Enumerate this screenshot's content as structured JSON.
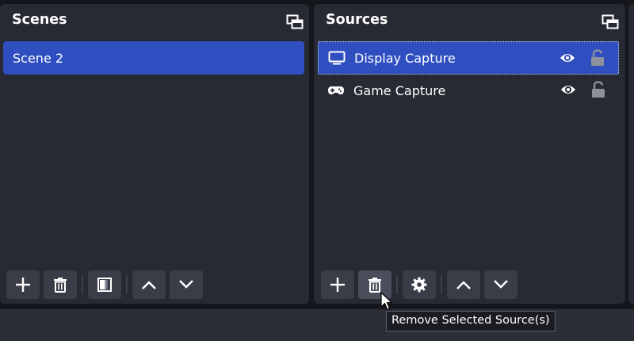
{
  "scenes_dock": {
    "title": "Scenes",
    "items": [
      {
        "label": "Scene 2",
        "selected": true
      }
    ],
    "toolbar": [
      "add-icon",
      "trash-icon",
      "filter-icon",
      "chevron-up-icon",
      "chevron-down-icon"
    ]
  },
  "sources_dock": {
    "title": "Sources",
    "items": [
      {
        "label": "Display Capture",
        "icon": "monitor-icon",
        "visible": true,
        "locked": false,
        "selected": true
      },
      {
        "label": "Game Capture",
        "icon": "gamepad-icon",
        "visible": true,
        "locked": false,
        "selected": false
      }
    ],
    "toolbar": [
      "add-icon",
      "trash-icon",
      "gear-icon",
      "chevron-up-icon",
      "chevron-down-icon"
    ]
  },
  "tooltip": {
    "text": "Remove Selected Source(s)"
  },
  "colors": {
    "selection": "#2f4ec0",
    "dock_bg": "#272a33",
    "app_bg": "#15161c",
    "button_bg": "#3a3d48"
  }
}
